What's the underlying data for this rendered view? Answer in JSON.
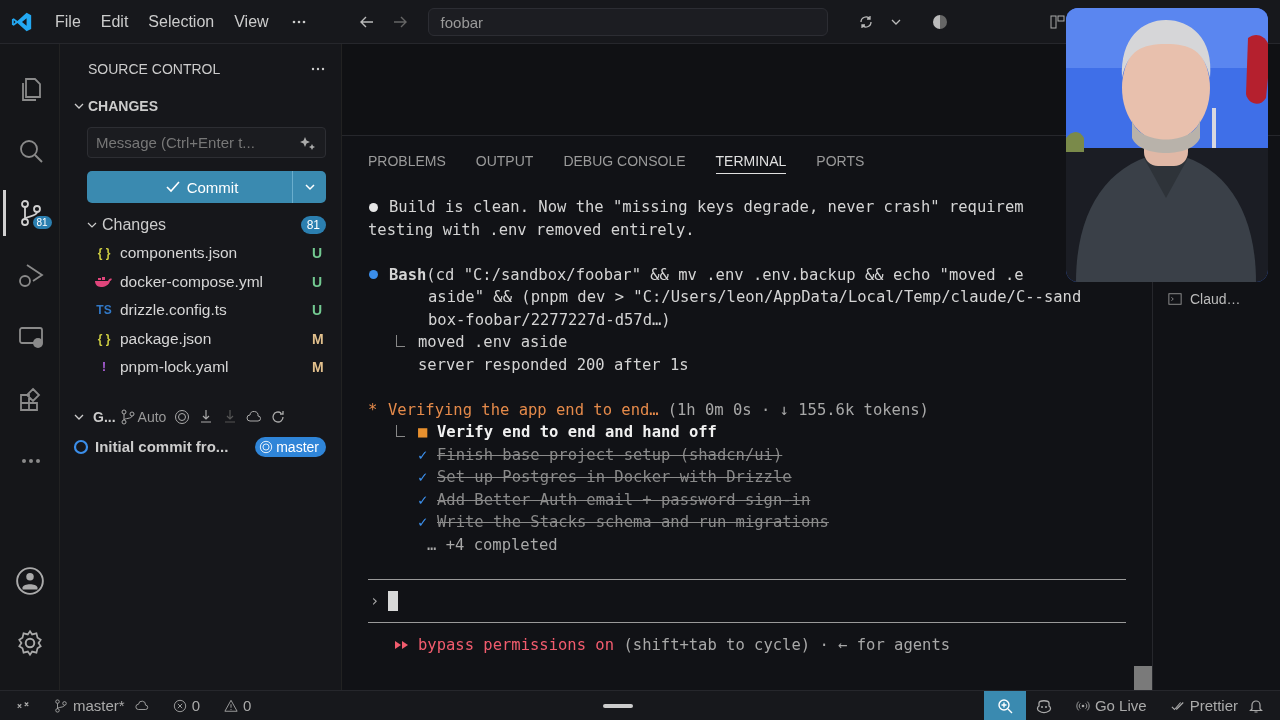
{
  "menu": [
    "File",
    "Edit",
    "Selection",
    "View"
  ],
  "search": {
    "value": "foobar"
  },
  "activity_bar": [
    {
      "kind": "explorer",
      "selected": false
    },
    {
      "kind": "search",
      "selected": false
    },
    {
      "kind": "source-control",
      "selected": true,
      "badge": "81"
    },
    {
      "kind": "run-debug",
      "selected": false
    },
    {
      "kind": "remote",
      "selected": false
    },
    {
      "kind": "extensions",
      "selected": false
    },
    {
      "kind": "more",
      "selected": false
    }
  ],
  "sidebar": {
    "title": "SOURCE CONTROL",
    "section": "CHANGES",
    "message": {
      "placeholder": "Message (Ctrl+Enter t..."
    },
    "commit_button": "Commit",
    "changes": {
      "label": "Changes",
      "count": "81",
      "expanded": true,
      "files": [
        {
          "icon": "{ }",
          "kind": "json",
          "name": "components.json",
          "status": "U"
        },
        {
          "kind": "docker",
          "name": "docker-compose.yml",
          "status": "U"
        },
        {
          "icon": "TS",
          "kind": "ts",
          "name": "drizzle.config.ts",
          "status": "U"
        },
        {
          "icon": "{ }",
          "kind": "json",
          "name": "package.json",
          "status": "M"
        },
        {
          "icon": "!",
          "kind": "yaml",
          "name": "pnpm-lock.yaml",
          "status": "M"
        }
      ]
    },
    "graph": {
      "label": "G...",
      "mode": "Auto",
      "expanded": true,
      "commits": [
        {
          "message": "Initial commit fro...",
          "branch": "master"
        }
      ]
    }
  },
  "panel": {
    "tabs": [
      {
        "label": "PROBLEMS",
        "selected": false
      },
      {
        "label": "OUTPUT",
        "selected": false
      },
      {
        "label": "DEBUG CONSOLE",
        "selected": false
      },
      {
        "label": "TERMINAL",
        "selected": true
      },
      {
        "label": "PORTS",
        "selected": false
      }
    ],
    "terminal": {
      "blocks": [
        {
          "kind": "message",
          "lines": [
            "Build is clean. Now the \"missing keys degrade, never crash\" requirem",
            "testing with .env removed entirely."
          ]
        },
        {
          "kind": "tool",
          "name": "Bash",
          "lines": [
            "(cd \"C:/sandbox/foobar\" && mv .env .env.backup && echo \"moved .e",
            "aside\" && (pnpm dev > \"C:/Users/leon/AppData/Local/Temp/claude/C--sand",
            "box-foobar/2277227d-d57d…)"
          ],
          "output": [
            "moved .env aside",
            "server responded 200 after 1s"
          ]
        },
        {
          "kind": "status",
          "star": "*",
          "title": "Verifying the app end to end…",
          "meta": "(1h 0m 0s · ↓ 155.6k tokens)",
          "tasks": [
            {
              "mark": "■",
              "text": "Verify end to end and hand off",
              "done": false
            },
            {
              "mark": "✓",
              "text": "Finish base project setup (shadcn/ui)",
              "done": true
            },
            {
              "mark": "✓",
              "text": "Set up Postgres in Docker with Drizzle",
              "done": true
            },
            {
              "mark": "✓",
              "text": "Add Better Auth email + password sign-in",
              "done": true
            },
            {
              "mark": "✓",
              "text": "Write the Stacks schema and run migrations",
              "done": true
            }
          ],
          "more": "… +4 completed"
        }
      ],
      "prompt": "›",
      "mode": {
        "label": "bypass permissions on",
        "hint": "(shift+tab to cycle) · ← for agents"
      }
    },
    "sessions": [
      {
        "label": "Claud…"
      }
    ]
  },
  "webcam": {
    "kind": "picture"
  },
  "status_bar": {
    "branch": "master*",
    "errors": "0",
    "warnings": "0",
    "zoom_active": true,
    "go_live": "Go Live",
    "formatter": "Prettier"
  }
}
